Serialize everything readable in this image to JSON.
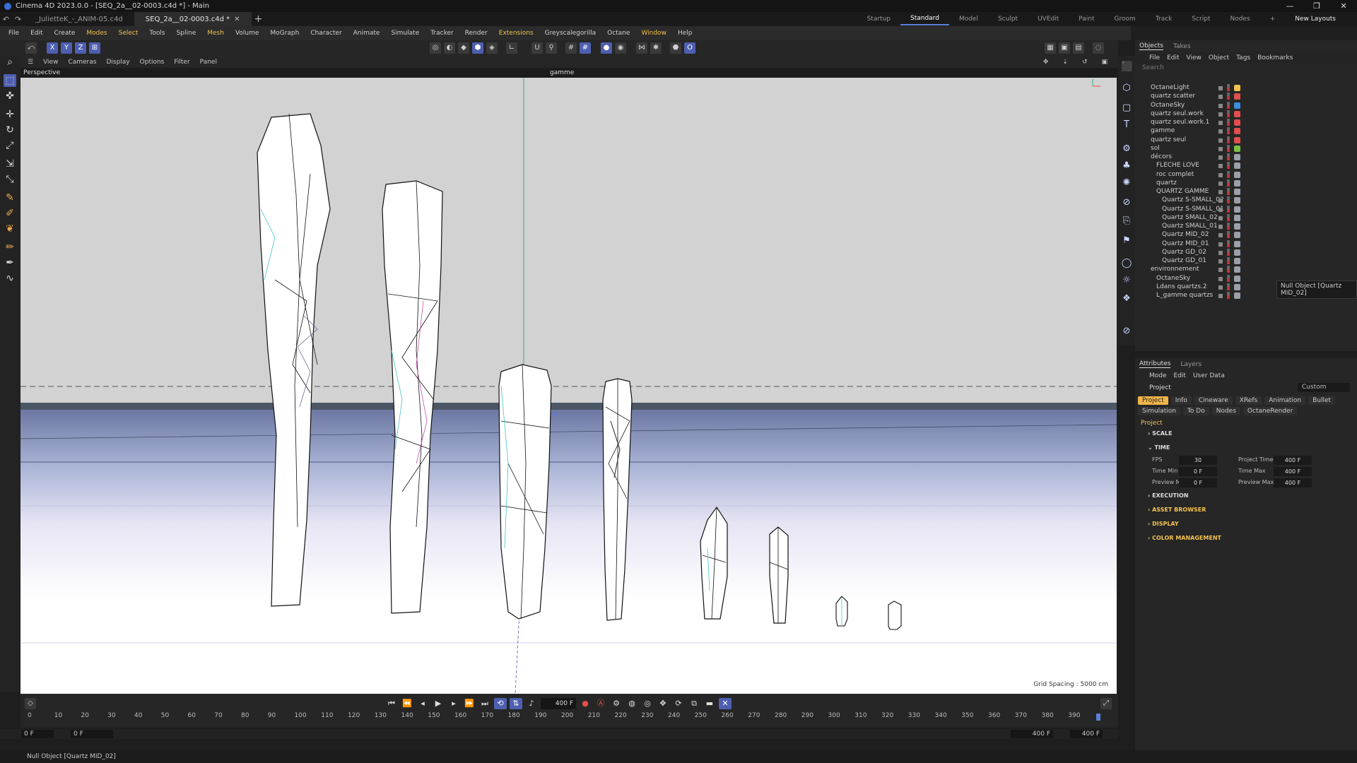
{
  "window": {
    "title": "Cinema 4D 2023.0.0 - [SEQ_2a__02-0003.c4d *] - Main",
    "controls": [
      "—",
      "❐",
      "✕"
    ]
  },
  "doc_tabs": [
    {
      "label": "_JulietteK_-_ANIM-05.c4d",
      "active": false
    },
    {
      "label": "SEQ_2a__02-0003.c4d *",
      "active": true
    }
  ],
  "layouts": [
    "Startup",
    "Standard",
    "Model",
    "Sculpt",
    "UVEdit",
    "Paint",
    "Groom",
    "Track",
    "Script",
    "Nodes"
  ],
  "active_layout": "Standard",
  "new_layouts_label": "New Layouts",
  "menu": [
    "File",
    "Edit",
    "Create",
    "Modes",
    "Select",
    "Tools",
    "Spline",
    "Mesh",
    "Volume",
    "MoGraph",
    "Character",
    "Animate",
    "Simulate",
    "Tracker",
    "Render",
    "Extensions",
    "Greyscalegorilla",
    "Octane",
    "Window",
    "Help"
  ],
  "viewport_menu": [
    "View",
    "Cameras",
    "Display",
    "Options",
    "Filter",
    "Panel"
  ],
  "viewport": {
    "name": "Perspective",
    "camera": "gamme",
    "grid_spacing": "Grid Spacing : 5000 cm"
  },
  "timeline": {
    "current_frame": "400 F",
    "ticks": [
      "0",
      "10",
      "20",
      "30",
      "40",
      "50",
      "60",
      "70",
      "80",
      "90",
      "100",
      "110",
      "120",
      "130",
      "140",
      "150",
      "160",
      "170",
      "180",
      "190",
      "200",
      "210",
      "220",
      "230",
      "240",
      "250",
      "260",
      "270",
      "280",
      "290",
      "300",
      "310",
      "320",
      "330",
      "340",
      "350",
      "360",
      "370",
      "380",
      "390"
    ],
    "start_field": "0 F",
    "min_field": "0 F",
    "max_field": "400 F",
    "end_field": "400 F"
  },
  "status": "Null Object [Quartz MID_02]",
  "objects_panel": {
    "tabs": [
      "Objects",
      "Takes"
    ],
    "menu": [
      "File",
      "Edit",
      "View",
      "Object",
      "Tags",
      "Bookmarks"
    ],
    "search_placeholder": "Search",
    "rows": [
      {
        "name": "OctaneLight",
        "indent": 0
      },
      {
        "name": "quartz scatter",
        "indent": 0
      },
      {
        "name": "OctaneSky",
        "indent": 0
      },
      {
        "name": "quartz seul.work",
        "indent": 0
      },
      {
        "name": "quartz seul.work.1",
        "indent": 0
      },
      {
        "name": "gamme",
        "indent": 0
      },
      {
        "name": "quartz seul",
        "indent": 0
      },
      {
        "name": "sol",
        "indent": 0
      },
      {
        "name": "décors",
        "indent": 0
      },
      {
        "name": "FLECHE LOVE",
        "indent": 1
      },
      {
        "name": "roc complet",
        "indent": 1
      },
      {
        "name": "quartz",
        "indent": 1
      },
      {
        "name": "QUARTZ GAMME",
        "indent": 1
      },
      {
        "name": "Quartz S-SMALL_02",
        "indent": 2
      },
      {
        "name": "Quartz S-SMALL_01",
        "indent": 2
      },
      {
        "name": "Quartz SMALL_02",
        "indent": 2
      },
      {
        "name": "Quartz SMALL_01",
        "indent": 2
      },
      {
        "name": "Quartz MID_02",
        "indent": 2
      },
      {
        "name": "Quartz MID_01",
        "indent": 2
      },
      {
        "name": "Quartz GD_02",
        "indent": 2
      },
      {
        "name": "Quartz GD_01",
        "indent": 2
      },
      {
        "name": "environnement",
        "indent": 0
      },
      {
        "name": "OctaneSky",
        "indent": 1
      },
      {
        "name": "Ldans quartzs.2",
        "indent": 1
      },
      {
        "name": "L_gamme quartzs",
        "indent": 1
      }
    ],
    "tooltip": "Null Object [Quartz MID_02]"
  },
  "attributes_panel": {
    "tabs": [
      "Attributes",
      "Layers"
    ],
    "menu": [
      "Mode",
      "Edit",
      "User Data"
    ],
    "object": "Project",
    "mode_value": "Custom",
    "buttons_row1": [
      "Project",
      "Info",
      "Cineware",
      "XRefs",
      "Animation",
      "Bullet"
    ],
    "buttons_row2": [
      "Simulation",
      "To Do",
      "Nodes",
      "OctaneRender"
    ],
    "section": "Project",
    "groups": [
      "SCALE",
      "TIME",
      "EXECUTION",
      "ASSET BROWSER",
      "DISPLAY",
      "COLOR MANAGEMENT"
    ],
    "time_fields": {
      "fps_label": "FPS",
      "fps": "30",
      "project_time_label": "Project Time",
      "project_time": "400 F",
      "time_min_label": "Time Min",
      "time_min": "0 F",
      "time_max_label": "Time Max",
      "time_max": "400 F",
      "preview_min_label": "Preview Min",
      "preview_min": "0 F",
      "preview_max_label": "Preview Max",
      "preview_max": "400 F"
    }
  },
  "colors": {
    "accent_blue": "#4e5fb0",
    "highlight_yellow": "#f2c14e",
    "panel_bg": "#262626"
  }
}
